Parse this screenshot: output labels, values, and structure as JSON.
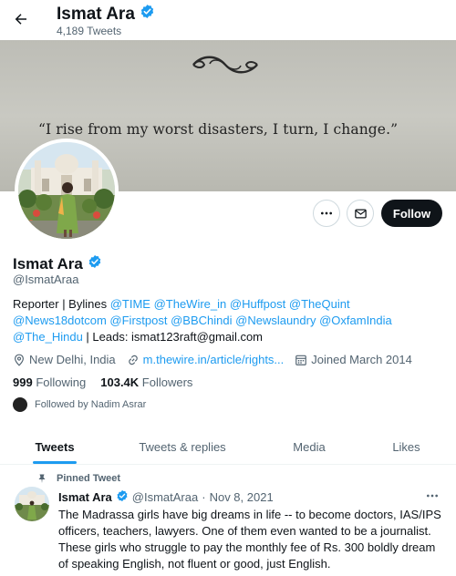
{
  "header": {
    "name": "Ismat Ara",
    "tweet_count": "4,189 Tweets"
  },
  "banner": {
    "quote": "“I rise from my worst disasters, I turn, I change.”"
  },
  "actions": {
    "more_icon": "more-horizontal-icon",
    "message_icon": "mail-icon",
    "follow_label": "Follow"
  },
  "profile": {
    "name": "Ismat Ara",
    "handle": "@IsmatAraa",
    "bio": {
      "prefix": "Reporter | Bylines ",
      "mentions": [
        "@TIME",
        "@TheWire_in",
        "@Huffpost",
        "@TheQuint",
        "@News18dotcom",
        "@Firstpost",
        "@BBChindi",
        "@Newslaundry",
        "@OxfamIndia",
        "@The_Hindu"
      ],
      "suffix": " | Leads: ismat123raft@gmail.com"
    },
    "location": "New Delhi, India",
    "website": "m.thewire.in/article/rights...",
    "joined": "Joined March 2014",
    "following_count": "999",
    "following_label": "Following",
    "followers_count": "103.4K",
    "followers_label": "Followers",
    "followed_by": "Followed by Nadim Asrar"
  },
  "tabs": [
    "Tweets",
    "Tweets & replies",
    "Media",
    "Likes"
  ],
  "pinned_tweet": {
    "label": "Pinned Tweet",
    "name": "Ismat Ara",
    "handle": "@IsmatAraa",
    "separator": "·",
    "date": "Nov 8, 2021",
    "text": "The Madrassa girls have big dreams in life -- to become doctors, IAS/IPS officers, teachers, lawyers. One of them even wanted to be a journalist. These girls who struggle to pay the monthly fee of Rs. 300 boldly dream of speaking English, not fluent or good, just English."
  },
  "colors": {
    "accent": "#1d9bf0",
    "text_primary": "#0f1419",
    "text_secondary": "#536471",
    "follow_button": "#0f1419"
  }
}
